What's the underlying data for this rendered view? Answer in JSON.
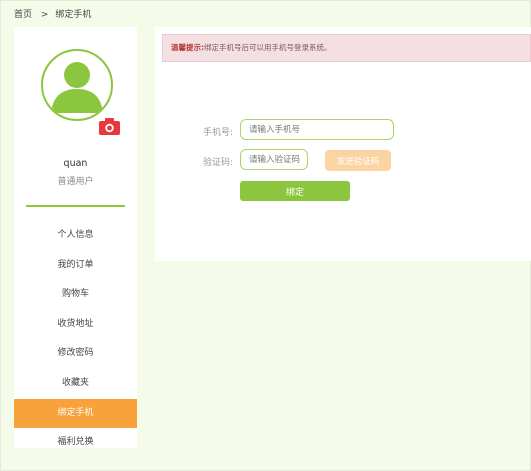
{
  "breadcrumb": {
    "home": "首页",
    "separator": ">",
    "current": "绑定手机"
  },
  "user": {
    "name": "quan",
    "type": "普通用户"
  },
  "sidebar": {
    "items": [
      {
        "label": "个人信息"
      },
      {
        "label": "我的订单"
      },
      {
        "label": "购物车"
      },
      {
        "label": "收货地址"
      },
      {
        "label": "修改密码"
      },
      {
        "label": "收藏夹"
      },
      {
        "label": "绑定手机"
      },
      {
        "label": "福利兑换"
      }
    ],
    "active_index": 6
  },
  "tip": {
    "title": "温馨提示:",
    "text": "绑定手机号后可以用手机号登录系统。"
  },
  "form": {
    "phone_label": "手机号:",
    "phone_placeholder": "请输入手机号",
    "phone_value": "",
    "code_label": "验证码:",
    "code_placeholder": "请输入验证码",
    "code_value": "",
    "send_code_label": "发送验证码",
    "submit_label": "绑定"
  },
  "colors": {
    "accent_green": "#8cc63f",
    "active_orange": "#f7a23a",
    "send_button": "#fcd4a4",
    "tip_background": "#f4dfe2",
    "camera_red": "#e8383d",
    "page_background": "#f4fbe9"
  },
  "icons": {
    "avatar": "user-avatar-icon",
    "camera": "camera-icon"
  }
}
